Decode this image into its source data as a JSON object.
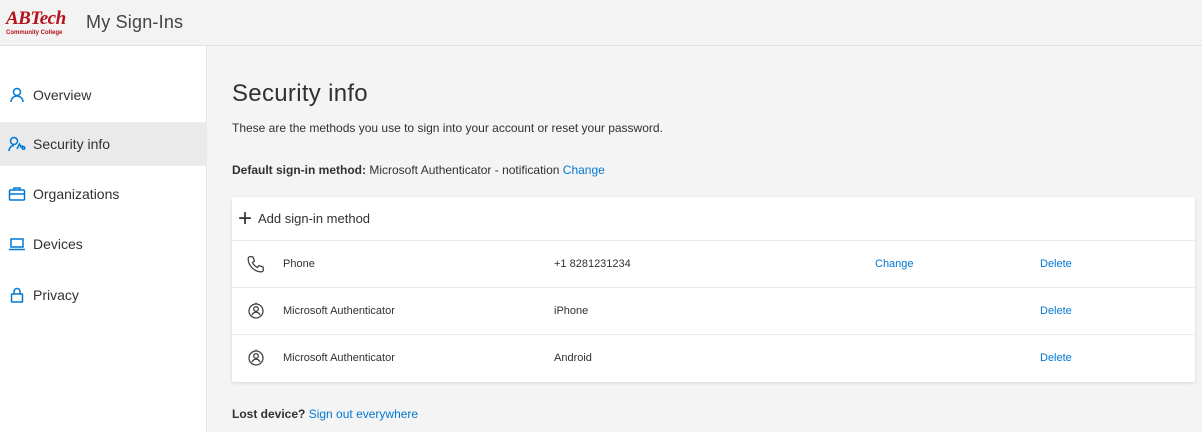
{
  "header": {
    "logo_main": "ABTech",
    "logo_sub": "Community College",
    "app_title": "My Sign-Ins"
  },
  "sidebar": {
    "items": [
      {
        "label": "Overview",
        "icon": "person-icon"
      },
      {
        "label": "Security info",
        "icon": "security-info-icon",
        "active": true
      },
      {
        "label": "Organizations",
        "icon": "briefcase-icon"
      },
      {
        "label": "Devices",
        "icon": "laptop-icon"
      },
      {
        "label": "Privacy",
        "icon": "lock-icon"
      }
    ]
  },
  "main": {
    "title": "Security info",
    "subtitle": "These are the methods you use to sign into your account or reset your password.",
    "default_label": "Default sign-in method:",
    "default_value": "Microsoft Authenticator - notification",
    "default_change": "Change",
    "add_method": "Add sign-in method",
    "methods": [
      {
        "name": "Phone",
        "detail": "+1 8281231234",
        "change": "Change",
        "delete": "Delete",
        "icon": "phone-icon"
      },
      {
        "name": "Microsoft Authenticator",
        "detail": "iPhone",
        "change": "",
        "delete": "Delete",
        "icon": "authenticator-icon"
      },
      {
        "name": "Microsoft Authenticator",
        "detail": "Android",
        "change": "",
        "delete": "Delete",
        "icon": "authenticator-icon"
      }
    ],
    "lost_label": "Lost device?",
    "lost_link": "Sign out everywhere"
  },
  "colors": {
    "accent": "#0078d4",
    "brand": "#b5121b"
  }
}
